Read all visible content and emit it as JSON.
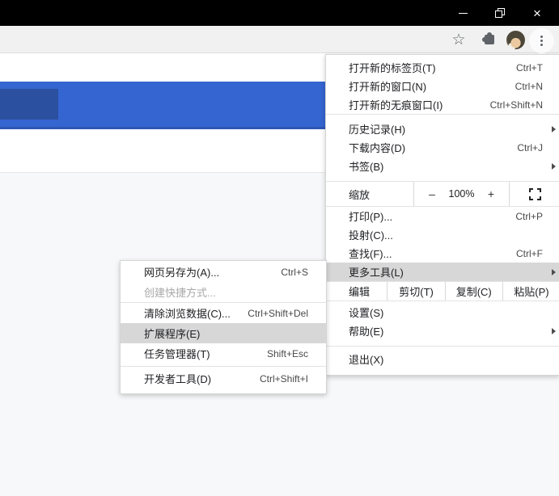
{
  "colors": {
    "titlebar": "#000000",
    "toolbar_bg": "#f1f1f1",
    "banner_blue": "#3465d0",
    "banner_dark_blue": "#2b509f",
    "menu_highlight": "#d7d7d7",
    "page_lower_bg": "#f7f8fa"
  },
  "titlebar": {
    "minimize": "–",
    "restore": "❐",
    "close": "×"
  },
  "toolbar": {
    "bookmark_star_glyph": "☆",
    "kebab_glyph": "⋮"
  },
  "menu": {
    "items": [
      {
        "label": "打开新的标签页(T)",
        "shortcut": "Ctrl+T"
      },
      {
        "label": "打开新的窗口(N)",
        "shortcut": "Ctrl+N"
      },
      {
        "label": "打开新的无痕窗口(I)",
        "shortcut": "Ctrl+Shift+N"
      },
      {
        "label": "历史记录(H)",
        "shortcut": ""
      },
      {
        "label": "下载内容(D)",
        "shortcut": "Ctrl+J"
      },
      {
        "label": "书签(B)",
        "shortcut": ""
      },
      {
        "label": "打印(P)...",
        "shortcut": "Ctrl+P"
      },
      {
        "label": "投射(C)...",
        "shortcut": ""
      },
      {
        "label": "查找(F)...",
        "shortcut": "Ctrl+F"
      },
      {
        "label": "更多工具(L)",
        "shortcut": ""
      },
      {
        "label": "设置(S)",
        "shortcut": ""
      },
      {
        "label": "帮助(E)",
        "shortcut": ""
      },
      {
        "label": "退出(X)",
        "shortcut": ""
      }
    ],
    "zoom_row": {
      "label": "缩放",
      "minus": "–",
      "value": "100%",
      "plus": "+"
    },
    "edit_row": {
      "label": "编辑",
      "cut": "剪切(T)",
      "copy": "复制(C)",
      "paste": "粘贴(P)"
    }
  },
  "submenu": {
    "items": [
      {
        "label": "网页另存为(A)...",
        "shortcut": "Ctrl+S"
      },
      {
        "label": "创建快捷方式...",
        "shortcut": ""
      },
      {
        "label": "清除浏览数据(C)...",
        "shortcut": "Ctrl+Shift+Del"
      },
      {
        "label": "扩展程序(E)",
        "shortcut": ""
      },
      {
        "label": "任务管理器(T)",
        "shortcut": "Shift+Esc"
      },
      {
        "label": "开发者工具(D)",
        "shortcut": "Ctrl+Shift+I"
      }
    ]
  }
}
